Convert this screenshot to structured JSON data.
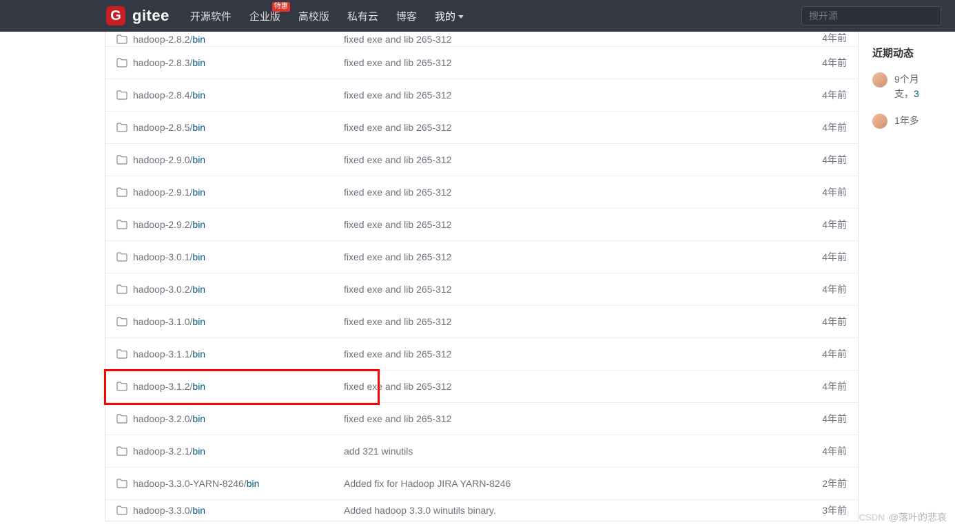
{
  "header": {
    "logo_text": "gitee",
    "nav": [
      {
        "label": "开源软件",
        "badge": ""
      },
      {
        "label": "企业版",
        "badge": "特惠"
      },
      {
        "label": "高校版",
        "badge": ""
      },
      {
        "label": "私有云",
        "badge": ""
      },
      {
        "label": "博客",
        "badge": ""
      },
      {
        "label": "我的",
        "badge": "",
        "dropdown": true,
        "active": true
      }
    ],
    "search_placeholder": "搜开源"
  },
  "files": [
    {
      "name": "hadoop-2.8.2/",
      "sub": "bin",
      "msg": "fixed exe and lib 265-312",
      "time": "4年前",
      "cutoff": true
    },
    {
      "name": "hadoop-2.8.3/",
      "sub": "bin",
      "msg": "fixed exe and lib 265-312",
      "time": "4年前"
    },
    {
      "name": "hadoop-2.8.4/",
      "sub": "bin",
      "msg": "fixed exe and lib 265-312",
      "time": "4年前"
    },
    {
      "name": "hadoop-2.8.5/",
      "sub": "bin",
      "msg": "fixed exe and lib 265-312",
      "time": "4年前"
    },
    {
      "name": "hadoop-2.9.0/",
      "sub": "bin",
      "msg": "fixed exe and lib 265-312",
      "time": "4年前"
    },
    {
      "name": "hadoop-2.9.1/",
      "sub": "bin",
      "msg": "fixed exe and lib 265-312",
      "time": "4年前"
    },
    {
      "name": "hadoop-2.9.2/",
      "sub": "bin",
      "msg": "fixed exe and lib 265-312",
      "time": "4年前"
    },
    {
      "name": "hadoop-3.0.1/",
      "sub": "bin",
      "msg": "fixed exe and lib 265-312",
      "time": "4年前"
    },
    {
      "name": "hadoop-3.0.2/",
      "sub": "bin",
      "msg": "fixed exe and lib 265-312",
      "time": "4年前"
    },
    {
      "name": "hadoop-3.1.0/",
      "sub": "bin",
      "msg": "fixed exe and lib 265-312",
      "time": "4年前"
    },
    {
      "name": "hadoop-3.1.1/",
      "sub": "bin",
      "msg": "fixed exe and lib 265-312",
      "time": "4年前"
    },
    {
      "name": "hadoop-3.1.2/",
      "sub": "bin",
      "msg": "fixed exe and lib 265-312",
      "time": "4年前",
      "highlight": true
    },
    {
      "name": "hadoop-3.2.0/",
      "sub": "bin",
      "msg": "fixed exe and lib 265-312",
      "time": "4年前"
    },
    {
      "name": "hadoop-3.2.1/",
      "sub": "bin",
      "msg": "add 321 winutils",
      "time": "4年前"
    },
    {
      "name": "hadoop-3.3.0-YARN-8246/",
      "sub": "bin",
      "msg": "Added fix for Hadoop JIRA YARN-8246",
      "time": "2年前"
    },
    {
      "name": "hadoop-3.3.0/",
      "sub": "bin",
      "msg": "Added hadoop 3.3.0 winutils binary.",
      "time": "3年前",
      "cutoff_bottom": true
    }
  ],
  "sidebar": {
    "title": "近期动态",
    "items": [
      {
        "time": "9个月",
        "text": "支，",
        "link": "3"
      },
      {
        "time": "1年多",
        "text": "",
        "link": ""
      }
    ]
  },
  "watermark": {
    "logo": "CSDN",
    "text": "@落叶的悲哀"
  }
}
